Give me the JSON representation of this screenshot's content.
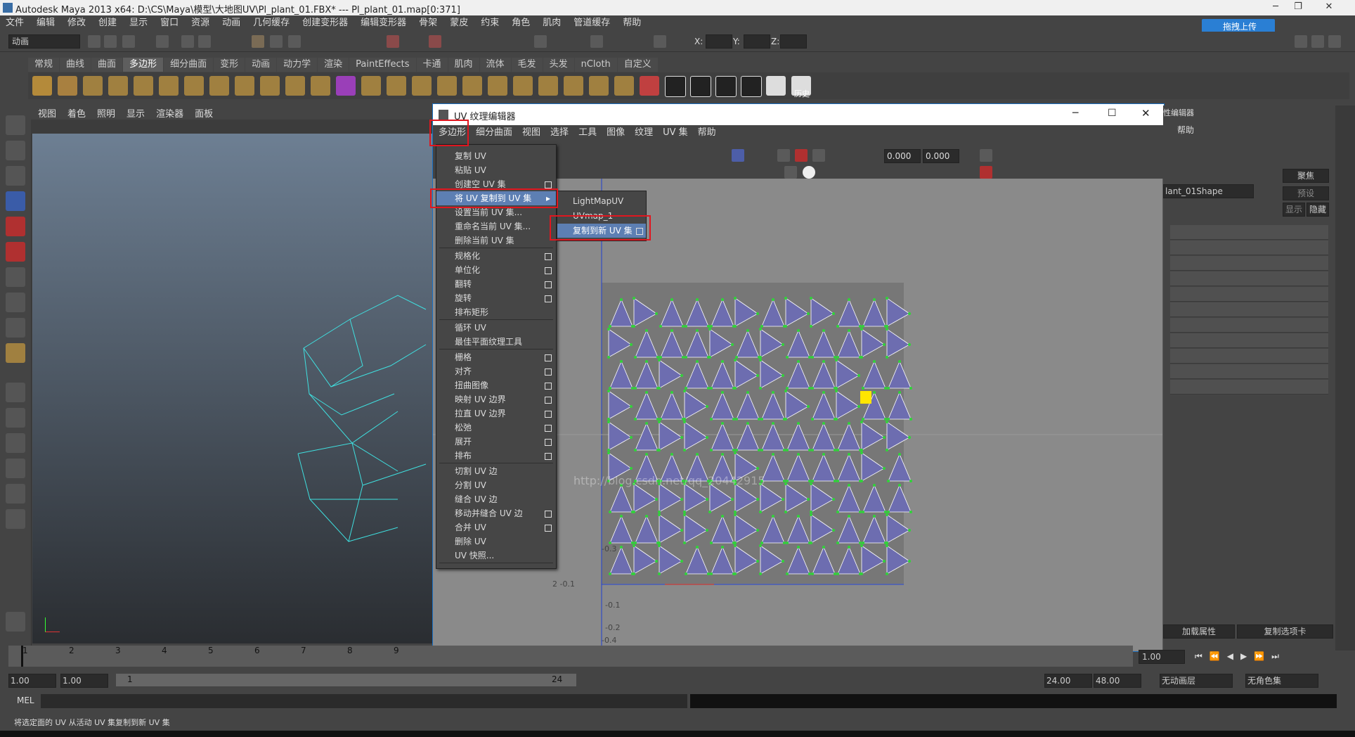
{
  "window": {
    "title": "Autodesk Maya 2013 x64: D:\\CS\\Maya\\模型\\大地图UV\\Pl_plant_01.FBX*   ---   Pl_plant_01.map[0:371]"
  },
  "main_menu": [
    "文件",
    "编辑",
    "修改",
    "创建",
    "显示",
    "窗口",
    "资源",
    "动画",
    "几何缓存",
    "创建变形器",
    "编辑变形器",
    "骨架",
    "蒙皮",
    "约束",
    "角色",
    "肌肉",
    "管道缓存",
    "帮助"
  ],
  "upload_button": "拖拽上传",
  "mode_combo": "动画",
  "coord_labels": {
    "x": "X:",
    "y": "Y:",
    "z": "Z:"
  },
  "shelf_tabs": [
    "常规",
    "曲线",
    "曲面",
    "多边形",
    "细分曲面",
    "变形",
    "动画",
    "动力学",
    "渲染",
    "PaintEffects",
    "卡通",
    "肌肉",
    "流体",
    "毛发",
    "头发",
    "nCloth",
    "自定义"
  ],
  "active_shelf_tab": "多边形",
  "history_label": "历史",
  "viewport_menu": [
    "视图",
    "着色",
    "照明",
    "显示",
    "渲染器",
    "面板"
  ],
  "uv_editor": {
    "title": "UV 纹理编辑器",
    "menu": [
      "多边形",
      "细分曲面",
      "视图",
      "选择",
      "工具",
      "图像",
      "纹理",
      "UV 集",
      "帮助"
    ],
    "field_u": "0.000",
    "field_v": "0.000",
    "axis_labels": [
      "-0.1",
      "-0.2",
      "-0.3",
      "-0.4"
    ],
    "corner_label": "2  -0.1",
    "watermark": "http://blog.csdn.net/qq_20442915"
  },
  "poly_menu": {
    "items": [
      {
        "label": "复制 UV",
        "option": false
      },
      {
        "label": "粘贴 UV",
        "option": false
      },
      {
        "label": "创建空 UV 集",
        "option": true
      },
      {
        "label": "将 UV 复制到 UV 集",
        "submenu": true,
        "highlighted": true
      },
      {
        "label": "设置当前 UV 集...",
        "option": false
      },
      {
        "label": "重命名当前 UV 集...",
        "option": false
      },
      {
        "label": "删除当前 UV 集",
        "option": false
      },
      {
        "label": "规格化",
        "option": true
      },
      {
        "label": "单位化",
        "option": true
      },
      {
        "label": "翻转",
        "option": true
      },
      {
        "label": "旋转",
        "option": true
      },
      {
        "label": "排布矩形",
        "option": false
      },
      {
        "label": "循环 UV",
        "option": false
      },
      {
        "label": "最佳平面纹理工具",
        "option": false
      },
      {
        "label": "栅格",
        "option": true
      },
      {
        "label": "对齐",
        "option": true
      },
      {
        "label": "扭曲图像",
        "option": true
      },
      {
        "label": "映射 UV 边界",
        "option": true
      },
      {
        "label": "拉直 UV 边界",
        "option": true
      },
      {
        "label": "松弛",
        "option": true
      },
      {
        "label": "展开",
        "option": true
      },
      {
        "label": "排布",
        "option": true
      },
      {
        "label": "切割 UV 边",
        "option": false
      },
      {
        "label": "分割 UV",
        "option": false
      },
      {
        "label": "缝合 UV 边",
        "option": false
      },
      {
        "label": "移动并缝合 UV 边",
        "option": true
      },
      {
        "label": "合并 UV",
        "option": true
      },
      {
        "label": "删除 UV",
        "option": false
      },
      {
        "label": "UV 快照...",
        "option": false
      }
    ]
  },
  "submenu": {
    "items": [
      "LightMapUV",
      "UVmap_1",
      "复制到新 UV 集"
    ],
    "highlighted": "复制到新 UV 集"
  },
  "right_panel": {
    "header": "性编辑器",
    "help": "帮助",
    "focus_button": "聚焦",
    "preset_button": "预设",
    "show_button": "显示",
    "hide_button": "隐藏",
    "shape_name": "lant_01Shape",
    "load_attr_button": "加载属性",
    "copy_tab_button": "复制选项卡"
  },
  "time_slider": {
    "ticks": [
      "1",
      "2",
      "3",
      "4",
      "5",
      "6",
      "7",
      "8",
      "9"
    ],
    "current": "1.00"
  },
  "range": {
    "start": "1.00",
    "start2": "1.00",
    "range_start": "1",
    "range_end": "24",
    "end": "24.00",
    "end2": "48.00",
    "anim_layer": "无动画层",
    "char_set": "无角色集"
  },
  "command_line": {
    "label": "MEL"
  },
  "help_line": "将选定面的 UV 从活动 UV 集复制到新 UV 集",
  "colors": {
    "uv_face": "#6d6db0",
    "uv_vertex": "#31d23a",
    "uv_edge": "#ffffff",
    "highlight": "#5d7fb3",
    "redbox": "#e0161f",
    "selected_vertex": "#ffe500"
  }
}
